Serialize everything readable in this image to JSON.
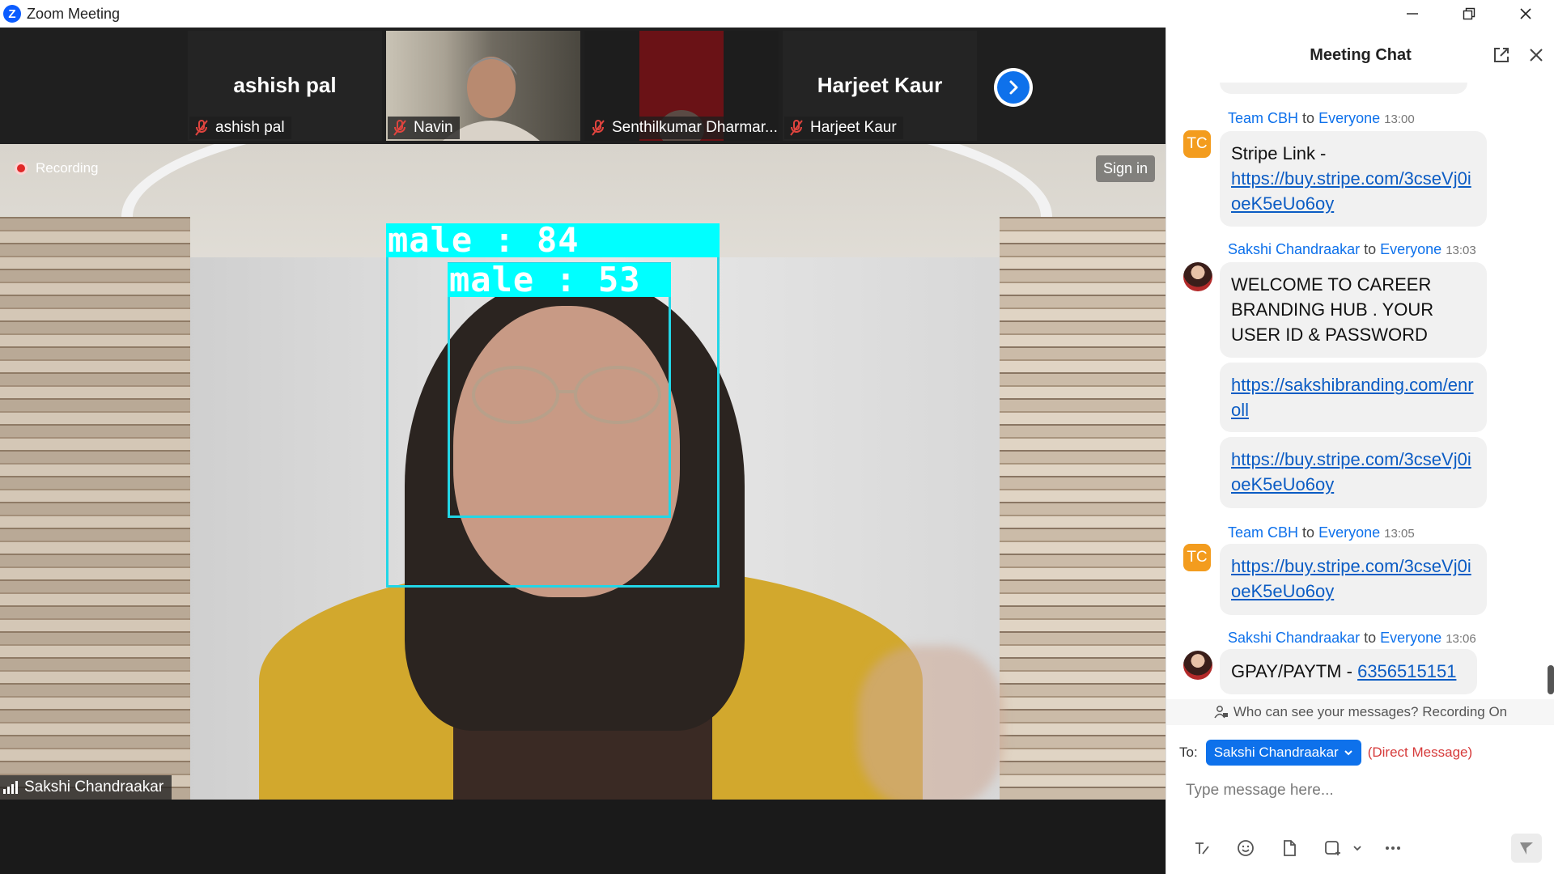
{
  "window": {
    "title": "Zoom Meeting",
    "logo_letter": "Z",
    "controls": [
      "minimize-icon",
      "restore-icon",
      "close-icon"
    ]
  },
  "participants": [
    {
      "display_name": "ashish pal",
      "label": "ashish pal",
      "muted": true,
      "video": false
    },
    {
      "display_name": "",
      "label": "Navin",
      "muted": true,
      "video": true
    },
    {
      "display_name": "",
      "label": "Senthilkumar Dharmar...",
      "muted": true,
      "video": true
    },
    {
      "display_name": "Harjeet Kaur",
      "label": "Harjeet Kaur",
      "muted": true,
      "video": false
    }
  ],
  "main_video": {
    "speaker_name": "Sakshi Chandraakar",
    "recording_label": "Recording",
    "sign_in_label": "Sign in",
    "detections": [
      {
        "label": "male : 84"
      },
      {
        "label": "male : 53"
      }
    ]
  },
  "chat": {
    "title": "Meeting Chat",
    "messages": [
      {
        "sender": "Team CBH",
        "to": "to",
        "recipient": "Everyone",
        "time": "13:00",
        "avatar": "TC",
        "bubbles": [
          {
            "text": "Stripe Link -",
            "link": "https://buy.stripe.com/3cseVj0ioeK5eUo6oy"
          }
        ]
      },
      {
        "sender": "Sakshi Chandraakar",
        "to": "to",
        "recipient": "Everyone",
        "time": "13:03",
        "avatar": "photo",
        "bubbles": [
          {
            "text": "WELCOME TO CAREER BRANDING HUB . YOUR USER ID & PASSWORD"
          },
          {
            "link": "https://sakshibranding.com/enroll"
          },
          {
            "link": "https://buy.stripe.com/3cseVj0ioeK5eUo6oy"
          }
        ]
      },
      {
        "sender": "Team CBH",
        "to": "to",
        "recipient": "Everyone",
        "time": "13:05",
        "avatar": "TC",
        "bubbles": [
          {
            "link": "https://buy.stripe.com/3cseVj0ioeK5eUo6oy"
          }
        ]
      },
      {
        "sender": "Sakshi Chandraakar",
        "to": "to",
        "recipient": "Everyone",
        "time": "13:06",
        "avatar": "photo",
        "bubbles": [
          {
            "text": "GPAY/PAYTM -",
            "link": "6356515151"
          }
        ]
      }
    ],
    "privacy_note": "Who can see your messages? Recording On",
    "to_label": "To:",
    "recipient_select": "Sakshi Chandraakar",
    "direct_message_note": "(Direct Message)",
    "input_placeholder": "Type message here..."
  },
  "colors": {
    "accent": "#0e71eb",
    "detection_box": "#22d6e6",
    "detection_label_bg": "#00ffff",
    "avatar_tc": "#f39c1e",
    "dm_note": "#d63a3a"
  }
}
